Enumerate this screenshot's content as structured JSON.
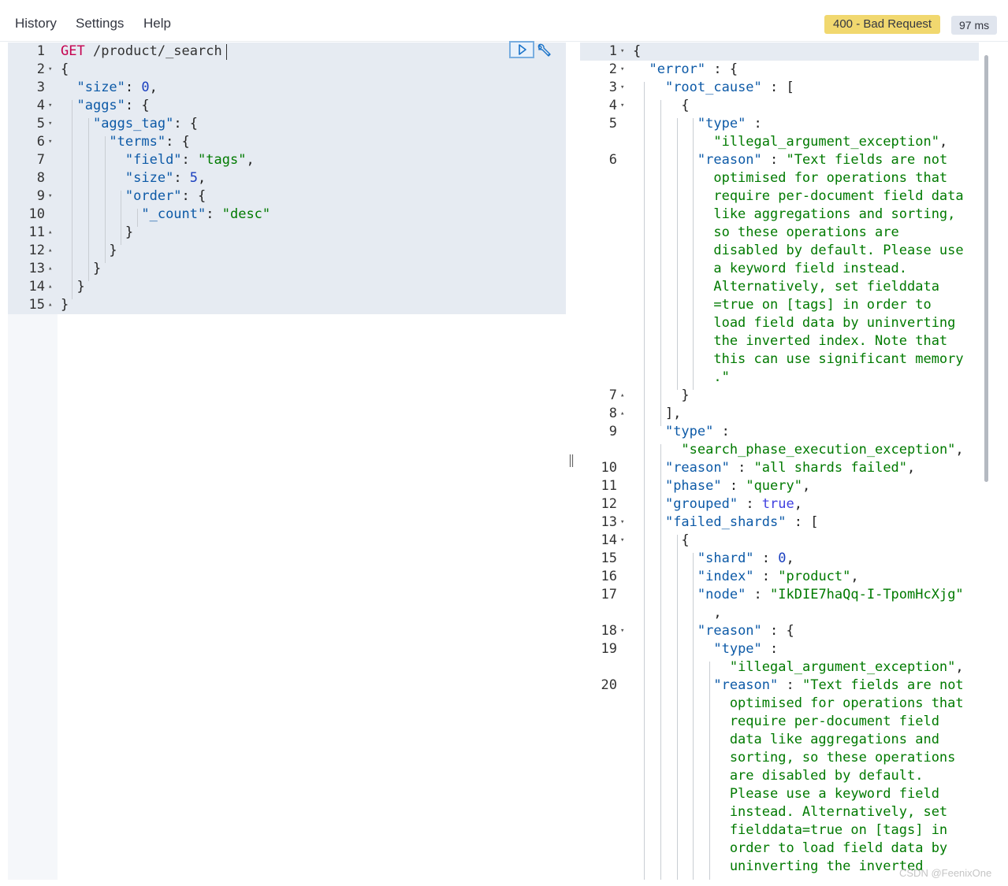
{
  "menu": {
    "history": "History",
    "settings": "Settings",
    "help": "Help"
  },
  "status": {
    "code_text": "400 - Bad Request",
    "time_text": "97 ms"
  },
  "request": {
    "lines": [
      {
        "num": "1",
        "fold": "",
        "tokens": [
          [
            "m",
            "GET"
          ],
          [
            "u",
            " /product/_search"
          ]
        ]
      },
      {
        "num": "2",
        "fold": "▾",
        "tokens": [
          [
            "p",
            "{"
          ]
        ]
      },
      {
        "num": "3",
        "fold": "",
        "tokens": [
          [
            "p",
            "  "
          ],
          [
            "k",
            "\"size\""
          ],
          [
            "p",
            ": "
          ],
          [
            "n",
            "0"
          ],
          [
            "p",
            ","
          ]
        ]
      },
      {
        "num": "4",
        "fold": "▾",
        "tokens": [
          [
            "p",
            "  "
          ],
          [
            "k",
            "\"aggs\""
          ],
          [
            "p",
            ": {"
          ]
        ]
      },
      {
        "num": "5",
        "fold": "▾",
        "tokens": [
          [
            "p",
            "    "
          ],
          [
            "k",
            "\"aggs_tag\""
          ],
          [
            "p",
            ": {"
          ]
        ]
      },
      {
        "num": "6",
        "fold": "▾",
        "tokens": [
          [
            "p",
            "      "
          ],
          [
            "k",
            "\"terms\""
          ],
          [
            "p",
            ": {"
          ]
        ]
      },
      {
        "num": "7",
        "fold": "",
        "tokens": [
          [
            "p",
            "        "
          ],
          [
            "k",
            "\"field\""
          ],
          [
            "p",
            ": "
          ],
          [
            "s",
            "\"tags\""
          ],
          [
            "p",
            ","
          ]
        ]
      },
      {
        "num": "8",
        "fold": "",
        "tokens": [
          [
            "p",
            "        "
          ],
          [
            "k",
            "\"size\""
          ],
          [
            "p",
            ": "
          ],
          [
            "n",
            "5"
          ],
          [
            "p",
            ","
          ]
        ]
      },
      {
        "num": "9",
        "fold": "▾",
        "tokens": [
          [
            "p",
            "        "
          ],
          [
            "k",
            "\"order\""
          ],
          [
            "p",
            ": {"
          ]
        ]
      },
      {
        "num": "10",
        "fold": "",
        "tokens": [
          [
            "p",
            "          "
          ],
          [
            "k",
            "\"_count\""
          ],
          [
            "p",
            ": "
          ],
          [
            "s",
            "\"desc\""
          ]
        ]
      },
      {
        "num": "11",
        "fold": "▴",
        "tokens": [
          [
            "p",
            "        }"
          ]
        ]
      },
      {
        "num": "12",
        "fold": "▴",
        "tokens": [
          [
            "p",
            "      }"
          ]
        ]
      },
      {
        "num": "13",
        "fold": "▴",
        "tokens": [
          [
            "p",
            "    }"
          ]
        ]
      },
      {
        "num": "14",
        "fold": "▴",
        "tokens": [
          [
            "p",
            "  }"
          ]
        ]
      },
      {
        "num": "15",
        "fold": "▴",
        "tokens": [
          [
            "p",
            "}"
          ]
        ]
      }
    ]
  },
  "response": {
    "lines": [
      {
        "num": "1",
        "fold": "▾",
        "tokens": [
          [
            "p",
            "{"
          ]
        ]
      },
      {
        "num": "2",
        "fold": "▾",
        "tokens": [
          [
            "p",
            "  "
          ],
          [
            "k",
            "\"error\""
          ],
          [
            "p",
            " : {"
          ]
        ]
      },
      {
        "num": "3",
        "fold": "▾",
        "tokens": [
          [
            "p",
            "    "
          ],
          [
            "k",
            "\"root_cause\""
          ],
          [
            "p",
            " : ["
          ]
        ]
      },
      {
        "num": "4",
        "fold": "▾",
        "tokens": [
          [
            "p",
            "      {"
          ]
        ]
      },
      {
        "num": "5",
        "fold": "",
        "tokens": [
          [
            "p",
            "        "
          ],
          [
            "k",
            "\"type\""
          ],
          [
            "p",
            " :"
          ]
        ]
      },
      {
        "num": "",
        "fold": "",
        "tokens": [
          [
            "p",
            "          "
          ],
          [
            "s",
            "\"illegal_argument_exception\""
          ],
          [
            "p",
            ","
          ]
        ]
      },
      {
        "num": "6",
        "fold": "",
        "tokens": [
          [
            "p",
            "        "
          ],
          [
            "k",
            "\"reason\""
          ],
          [
            "p",
            " : "
          ],
          [
            "s",
            "\"Text fields are not"
          ]
        ]
      },
      {
        "num": "",
        "fold": "",
        "tokens": [
          [
            "s",
            "          optimised for operations that"
          ]
        ]
      },
      {
        "num": "",
        "fold": "",
        "tokens": [
          [
            "s",
            "          require per-document field data"
          ]
        ]
      },
      {
        "num": "",
        "fold": "",
        "tokens": [
          [
            "s",
            "          like aggregations and sorting,"
          ]
        ]
      },
      {
        "num": "",
        "fold": "",
        "tokens": [
          [
            "s",
            "          so these operations are"
          ]
        ]
      },
      {
        "num": "",
        "fold": "",
        "tokens": [
          [
            "s",
            "          disabled by default. Please use"
          ]
        ]
      },
      {
        "num": "",
        "fold": "",
        "tokens": [
          [
            "s",
            "          a keyword field instead."
          ]
        ]
      },
      {
        "num": "",
        "fold": "",
        "tokens": [
          [
            "s",
            "          Alternatively, set fielddata"
          ]
        ]
      },
      {
        "num": "",
        "fold": "",
        "tokens": [
          [
            "s",
            "          =true on [tags] in order to"
          ]
        ]
      },
      {
        "num": "",
        "fold": "",
        "tokens": [
          [
            "s",
            "          load field data by uninverting"
          ]
        ]
      },
      {
        "num": "",
        "fold": "",
        "tokens": [
          [
            "s",
            "          the inverted index. Note that"
          ]
        ]
      },
      {
        "num": "",
        "fold": "",
        "tokens": [
          [
            "s",
            "          this can use significant memory"
          ]
        ]
      },
      {
        "num": "",
        "fold": "",
        "tokens": [
          [
            "s",
            "          .\""
          ]
        ]
      },
      {
        "num": "7",
        "fold": "▴",
        "tokens": [
          [
            "p",
            "      }"
          ]
        ]
      },
      {
        "num": "8",
        "fold": "▴",
        "tokens": [
          [
            "p",
            "    ],"
          ]
        ]
      },
      {
        "num": "9",
        "fold": "",
        "tokens": [
          [
            "p",
            "    "
          ],
          [
            "k",
            "\"type\""
          ],
          [
            "p",
            " :"
          ]
        ]
      },
      {
        "num": "",
        "fold": "",
        "tokens": [
          [
            "p",
            "      "
          ],
          [
            "s",
            "\"search_phase_execution_exception\""
          ],
          [
            "p",
            ","
          ]
        ]
      },
      {
        "num": "10",
        "fold": "",
        "tokens": [
          [
            "p",
            "    "
          ],
          [
            "k",
            "\"reason\""
          ],
          [
            "p",
            " : "
          ],
          [
            "s",
            "\"all shards failed\""
          ],
          [
            "p",
            ","
          ]
        ]
      },
      {
        "num": "11",
        "fold": "",
        "tokens": [
          [
            "p",
            "    "
          ],
          [
            "k",
            "\"phase\""
          ],
          [
            "p",
            " : "
          ],
          [
            "s",
            "\"query\""
          ],
          [
            "p",
            ","
          ]
        ]
      },
      {
        "num": "12",
        "fold": "",
        "tokens": [
          [
            "p",
            "    "
          ],
          [
            "k",
            "\"grouped\""
          ],
          [
            "p",
            " : "
          ],
          [
            "b",
            "true"
          ],
          [
            "p",
            ","
          ]
        ]
      },
      {
        "num": "13",
        "fold": "▾",
        "tokens": [
          [
            "p",
            "    "
          ],
          [
            "k",
            "\"failed_shards\""
          ],
          [
            "p",
            " : ["
          ]
        ]
      },
      {
        "num": "14",
        "fold": "▾",
        "tokens": [
          [
            "p",
            "      {"
          ]
        ]
      },
      {
        "num": "15",
        "fold": "",
        "tokens": [
          [
            "p",
            "        "
          ],
          [
            "k",
            "\"shard\""
          ],
          [
            "p",
            " : "
          ],
          [
            "n",
            "0"
          ],
          [
            "p",
            ","
          ]
        ]
      },
      {
        "num": "16",
        "fold": "",
        "tokens": [
          [
            "p",
            "        "
          ],
          [
            "k",
            "\"index\""
          ],
          [
            "p",
            " : "
          ],
          [
            "s",
            "\"product\""
          ],
          [
            "p",
            ","
          ]
        ]
      },
      {
        "num": "17",
        "fold": "",
        "tokens": [
          [
            "p",
            "        "
          ],
          [
            "k",
            "\"node\""
          ],
          [
            "p",
            " : "
          ],
          [
            "s",
            "\"IkDIE7haQq-I-TpomHcXjg\""
          ]
        ]
      },
      {
        "num": "",
        "fold": "",
        "tokens": [
          [
            "p",
            "          ,"
          ]
        ]
      },
      {
        "num": "18",
        "fold": "▾",
        "tokens": [
          [
            "p",
            "        "
          ],
          [
            "k",
            "\"reason\""
          ],
          [
            "p",
            " : {"
          ]
        ]
      },
      {
        "num": "19",
        "fold": "",
        "tokens": [
          [
            "p",
            "          "
          ],
          [
            "k",
            "\"type\""
          ],
          [
            "p",
            " :"
          ]
        ]
      },
      {
        "num": "",
        "fold": "",
        "tokens": [
          [
            "p",
            "            "
          ],
          [
            "s",
            "\"illegal_argument_exception\""
          ],
          [
            "p",
            ","
          ]
        ]
      },
      {
        "num": "20",
        "fold": "",
        "tokens": [
          [
            "p",
            "          "
          ],
          [
            "k",
            "\"reason\""
          ],
          [
            "p",
            " : "
          ],
          [
            "s",
            "\"Text fields are not"
          ]
        ]
      },
      {
        "num": "",
        "fold": "",
        "tokens": [
          [
            "s",
            "            optimised for operations that"
          ]
        ]
      },
      {
        "num": "",
        "fold": "",
        "tokens": [
          [
            "s",
            "            require per-document field"
          ]
        ]
      },
      {
        "num": "",
        "fold": "",
        "tokens": [
          [
            "s",
            "            data like aggregations and"
          ]
        ]
      },
      {
        "num": "",
        "fold": "",
        "tokens": [
          [
            "s",
            "            sorting, so these operations"
          ]
        ]
      },
      {
        "num": "",
        "fold": "",
        "tokens": [
          [
            "s",
            "            are disabled by default."
          ]
        ]
      },
      {
        "num": "",
        "fold": "",
        "tokens": [
          [
            "s",
            "            Please use a keyword field"
          ]
        ]
      },
      {
        "num": "",
        "fold": "",
        "tokens": [
          [
            "s",
            "            instead. Alternatively, set"
          ]
        ]
      },
      {
        "num": "",
        "fold": "",
        "tokens": [
          [
            "s",
            "            fielddata=true on [tags] in"
          ]
        ]
      },
      {
        "num": "",
        "fold": "",
        "tokens": [
          [
            "s",
            "            order to load field data by"
          ]
        ]
      },
      {
        "num": "",
        "fold": "",
        "tokens": [
          [
            "s",
            "            uninverting the inverted"
          ]
        ]
      }
    ]
  },
  "watermark": "CSDN @FeenixOne",
  "icons": {
    "run": "play-icon",
    "settings": "wrench-icon",
    "divider": "resize-handle-icon"
  },
  "colors": {
    "status_badge": "#f1d86f",
    "time_badge": "#e0e5ee",
    "key": "#0d5aa7",
    "string": "#007a00",
    "method": "#c5004e"
  }
}
